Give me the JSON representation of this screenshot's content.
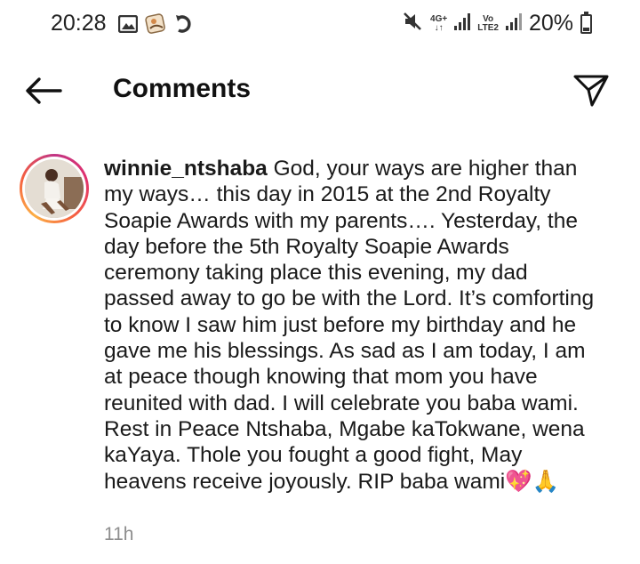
{
  "status_bar": {
    "time": "20:28",
    "network_label": "4G+",
    "network_sub": "↓↑",
    "volte_label": "Vo",
    "volte_sub": "LTE2",
    "battery_percent": "20%",
    "battery_level": 0.2
  },
  "header": {
    "title": "Comments"
  },
  "comment": {
    "username": "winnie_ntshaba",
    "text": "God, your ways are higher than my ways… this day in 2015 at the 2nd Royalty Soapie Awards with my parents…. Yesterday, the day before the 5th Royalty Soapie Awards ceremony taking place this evening, my dad passed away to go be with the Lord. It’s comforting to know I saw him just before my birthday and he gave me his blessings. As sad as I am today, I am at peace though knowing that mom you have reunited with dad. I will celebrate you baba wami. Rest in Peace Ntshaba, Mgabe kaTokwane, wena kaYaya. Thole you fought a good fight, May heavens receive joyously. RIP baba wami",
    "emoji": "💖🙏",
    "timestamp": "11h"
  },
  "icons": {
    "back": "arrow-left-icon",
    "send": "paper-plane-icon",
    "mute": "mute-icon",
    "gallery": "image-icon",
    "sticker": "sticker-icon",
    "sync": "sync-icon"
  },
  "colors": {
    "story_ring": "#e1306c",
    "timestamp": "#8e8e8e"
  }
}
